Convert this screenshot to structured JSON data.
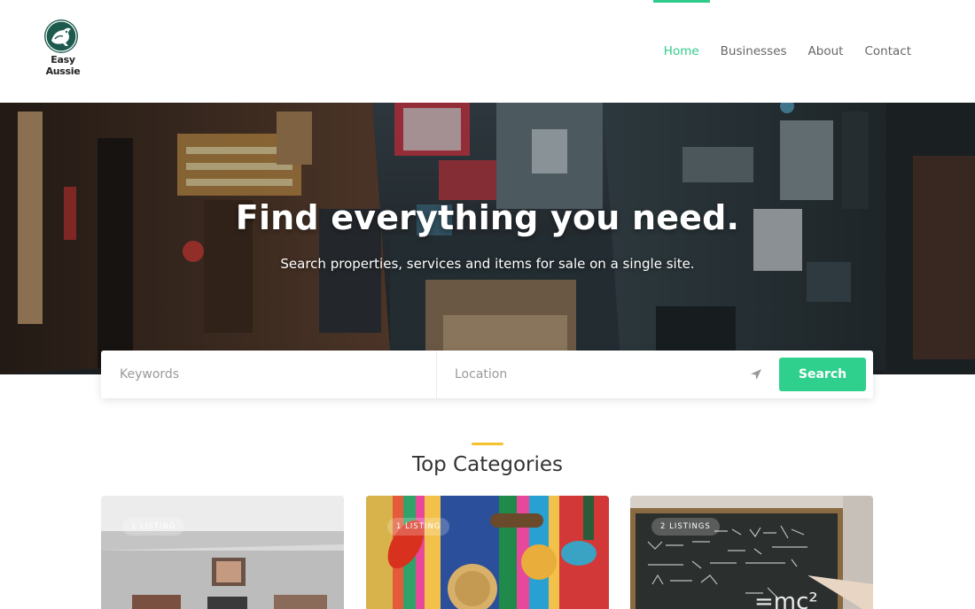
{
  "header": {
    "logo_text": "Easy Aussie",
    "nav": [
      {
        "label": "Home",
        "active": true
      },
      {
        "label": "Businesses",
        "active": false
      },
      {
        "label": "About",
        "active": false
      },
      {
        "label": "Contact",
        "active": false
      }
    ]
  },
  "hero": {
    "title": "Find everything you need.",
    "subtitle": "Search properties, services and items for sale on a single site."
  },
  "search": {
    "keywords_placeholder": "Keywords",
    "location_placeholder": "Location",
    "button_label": "Search"
  },
  "categories": {
    "title": "Top Categories",
    "cards": [
      {
        "badge": "1 LISTING"
      },
      {
        "badge": "1 LISTING"
      },
      {
        "badge": "2 LISTINGS"
      }
    ]
  },
  "colors": {
    "accent": "#2ecc8b",
    "divider": "#f5c22b",
    "logo": "#1d5a4e"
  }
}
